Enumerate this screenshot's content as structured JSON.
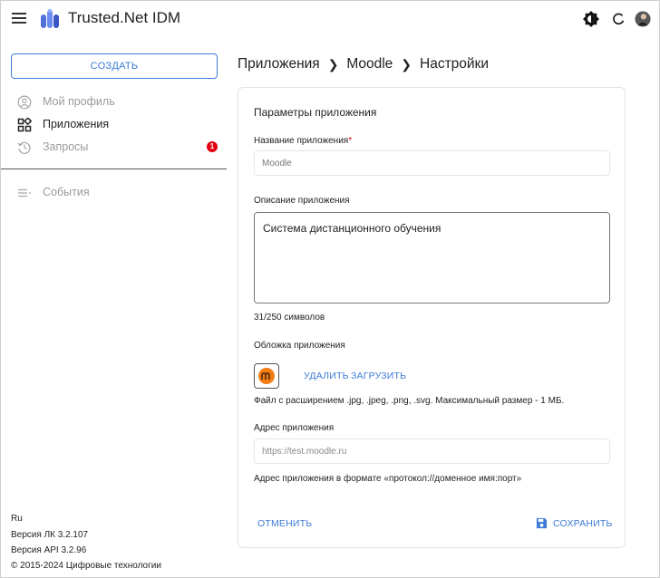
{
  "header": {
    "title": "Trusted.Net IDM"
  },
  "sidebar": {
    "create_label": "СОЗДАТЬ",
    "items": [
      {
        "label": "Мой профиль",
        "icon": "user-circle-icon"
      },
      {
        "label": "Приложения",
        "icon": "apps-grid-icon"
      },
      {
        "label": "Запросы",
        "icon": "history-icon",
        "badge": "1"
      },
      {
        "label": "События",
        "icon": "list-icon"
      }
    ],
    "footer": {
      "language": "Ru",
      "lk_version": "Версия ЛК 3.2.107",
      "api_version": "Версия API 3.2.96",
      "copyright": "© 2015-2024 Цифровые технологии"
    }
  },
  "breadcrumb": [
    "Приложения",
    "Moodle",
    "Настройки"
  ],
  "form": {
    "section_title": "Параметры приложения",
    "name_label": "Название приложения",
    "name_value": "Moodle",
    "description_label": "Описание приложения",
    "description_value": "Система дистанционного обучения",
    "description_counter": "31/250 символов",
    "cover_label": "Обложка приложения",
    "delete_label": "УДАЛИТЬ",
    "upload_label": "ЗАГРУЗИТЬ",
    "file_hint": "Файл с расширением .jpg, .jpeg, .png, .svg. Максимальный размер - 1 МБ.",
    "address_label": "Адрес приложения",
    "address_placeholder": "https://test.moodle.ru",
    "address_hint": "Адрес приложения в формате «протокол://доменное имя:порт»",
    "cancel_label": "ОТМЕНИТЬ",
    "save_label": "СОХРАНИТЬ"
  },
  "colors": {
    "accent": "#3d7bd6",
    "badge": "#e00012",
    "moodle_orange": "#f47d16"
  }
}
